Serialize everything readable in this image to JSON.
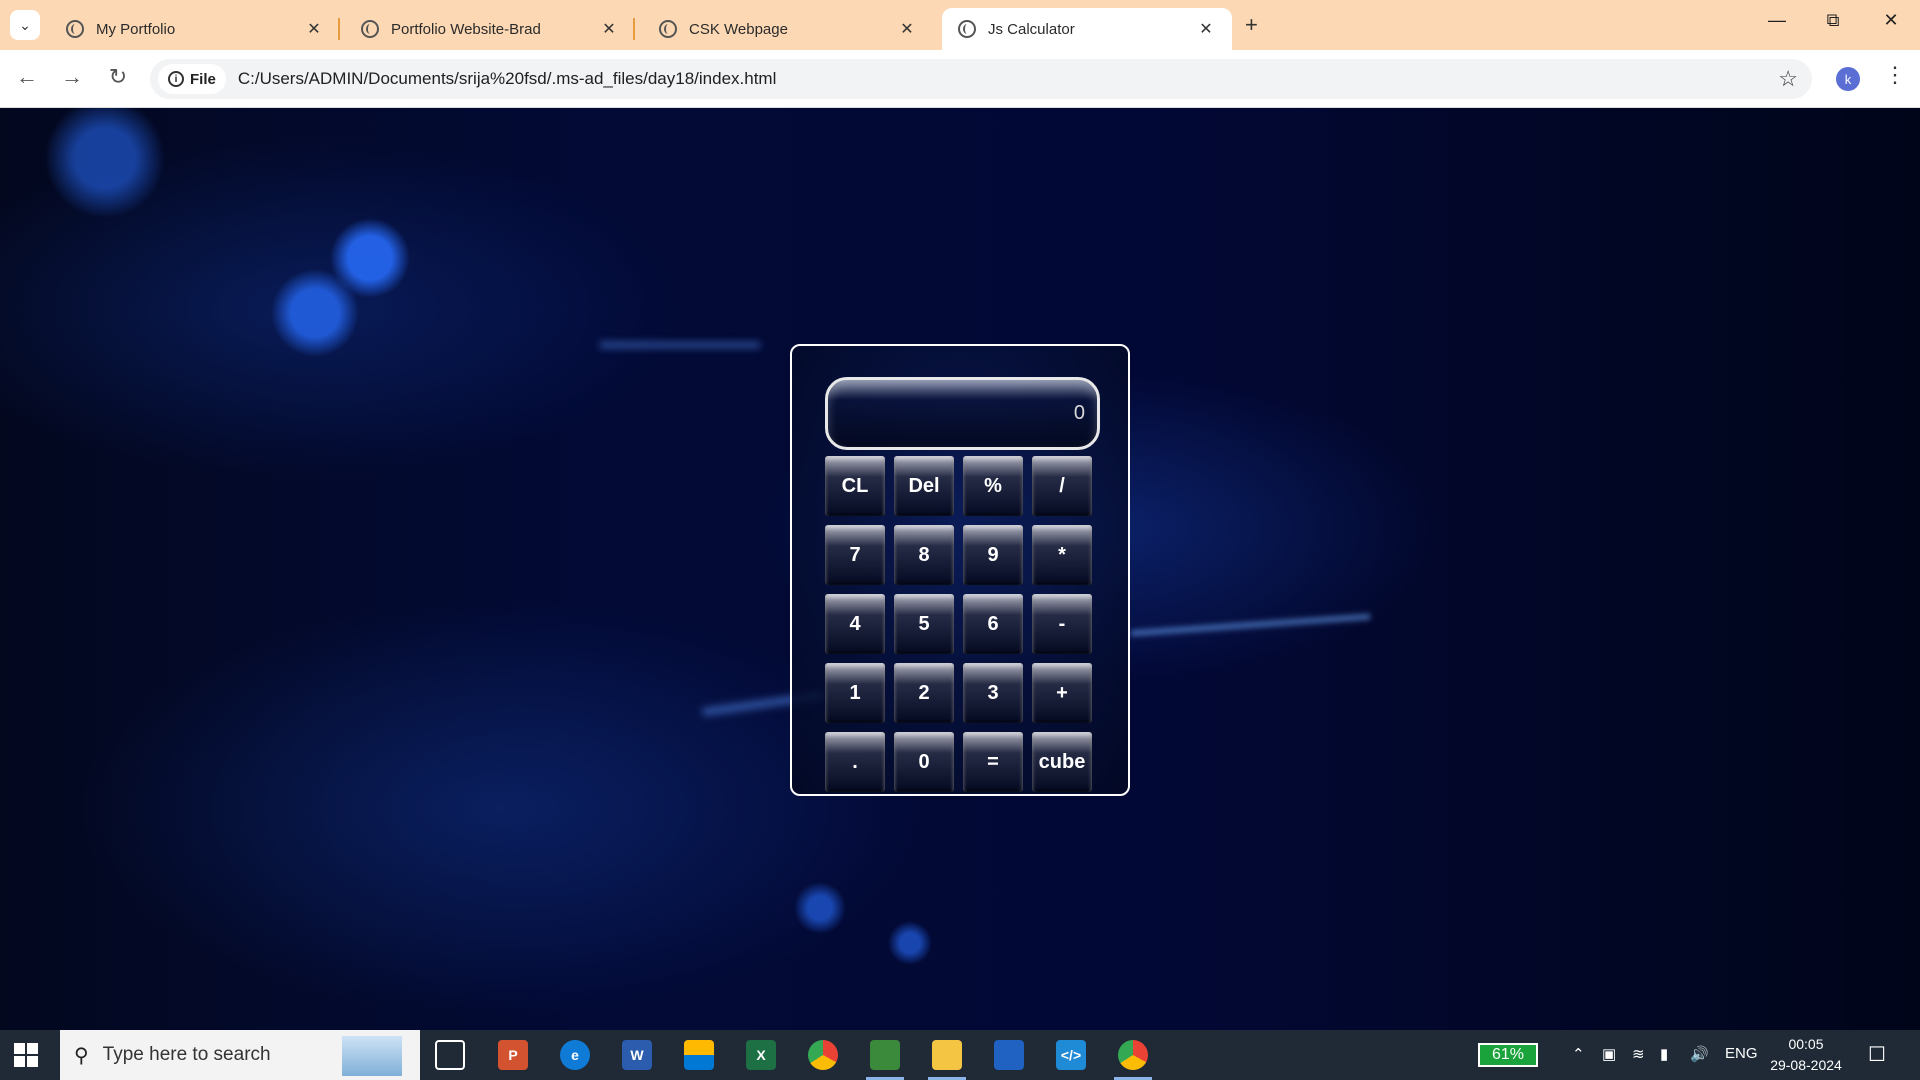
{
  "browser": {
    "tabs": [
      {
        "title": "My Portfolio",
        "active": false
      },
      {
        "title": "Portfolio Website-Brad",
        "active": false
      },
      {
        "title": "CSK Webpage",
        "active": false
      },
      {
        "title": "Js Calculator",
        "active": true
      }
    ],
    "address": {
      "chip_label": "File",
      "url": "C:/Users/ADMIN/Documents/srija%20fsd/.ms-ad_files/day18/index.html"
    },
    "profile_initial": "k"
  },
  "calculator": {
    "display_value": "0",
    "keys": [
      "CL",
      "Del",
      "%",
      "/",
      "7",
      "8",
      "9",
      "*",
      "4",
      "5",
      "6",
      "-",
      "1",
      "2",
      "3",
      "+",
      ".",
      "0",
      "=",
      "cube"
    ]
  },
  "taskbar": {
    "search_placeholder": "Type here to search",
    "battery": "61%",
    "language": "ENG",
    "time": "00:05",
    "date": "29-08-2024"
  },
  "colors": {
    "tabbar_bg": "#fcd9b4",
    "taskbar_bg": "#1f2a36",
    "battery_green": "#1aa33a"
  }
}
